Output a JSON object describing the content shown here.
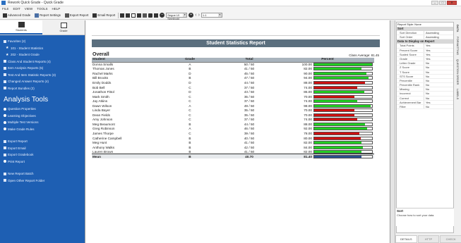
{
  "window": {
    "title": "Rework Quick Grade - Quick Grade"
  },
  "menu": [
    "FILE",
    "EDIT",
    "VIEW",
    "TOOLS",
    "HELP"
  ],
  "toolbar": {
    "buttons": [
      "Advanced Grade",
      "Report Settings",
      "Export Report",
      "Email Report"
    ],
    "font_combo": "Segoe UI Semibold",
    "zoom_combo": "1:1"
  },
  "sidebar": {
    "tabs": [
      "Students",
      "Grade"
    ],
    "items_top": [
      {
        "label": "Favorites (2)"
      },
      {
        "label": "101 - Student Statistics"
      },
      {
        "label": "202 - Student Grade"
      },
      {
        "label": "Class And Student Reports (4)"
      },
      {
        "label": "Item Analysis Reports (5)"
      },
      {
        "label": "Test And Item Statistic Reports (3)"
      },
      {
        "label": "Changed Answer Reports (4)"
      },
      {
        "label": "Report Bundles (2)"
      }
    ],
    "section_title": "Analysis Tools",
    "tools": [
      {
        "label": "Question Properties"
      },
      {
        "label": "Learning Objectives"
      },
      {
        "label": "Multiple Test Versions"
      },
      {
        "label": "Make Grade Rules"
      }
    ],
    "export_items": [
      {
        "label": "Export Report"
      },
      {
        "label": "Export Email"
      },
      {
        "label": "Export Gradebook"
      },
      {
        "label": "Print Report"
      }
    ],
    "bottom_items": [
      {
        "label": "New Report Batch"
      },
      {
        "label": "Open Other Report Folder"
      }
    ]
  },
  "report": {
    "title": "Student Statistics Report",
    "overall_label": "Overall",
    "class_average": "Class Average: 81.45",
    "columns": [
      "Student",
      "Grade",
      "Total",
      "Percent"
    ],
    "rows": [
      {
        "name": "Donna Smalls",
        "grade": "A",
        "total": "50 / 50",
        "pct": "100.00",
        "value": 100,
        "color": "#22cc22"
      },
      {
        "name": "Thomas Jones",
        "grade": "B",
        "total": "41 / 50",
        "pct": "82.00",
        "value": 82,
        "color": "#22cc22"
      },
      {
        "name": "Rachel Marks",
        "grade": "D",
        "total": "45 / 50",
        "pct": "90.00",
        "value": 90,
        "color": "#22cc22"
      },
      {
        "name": "Bill Brooks",
        "grade": "B",
        "total": "47 / 50",
        "pct": "94.00",
        "value": 94,
        "color": "#22cc22"
      },
      {
        "name": "Emily Dodds",
        "grade": "D",
        "total": "44 / 50",
        "pct": "88.00",
        "value": 88,
        "color": "#cc1111"
      },
      {
        "name": "Bob Bell",
        "grade": "C",
        "total": "37 / 50",
        "pct": "74.00",
        "value": 74,
        "color": "#cc1111"
      },
      {
        "name": "Jonathon Fittol",
        "grade": "D",
        "total": "43 / 50",
        "pct": "86.00",
        "value": 86,
        "color": "#22cc22"
      },
      {
        "name": "Mark Smith",
        "grade": "C",
        "total": "35 / 50",
        "pct": "70.00",
        "value": 70,
        "color": "#cc1111"
      },
      {
        "name": "Jay Atkins",
        "grade": "C",
        "total": "37 / 50",
        "pct": "74.00",
        "value": 74,
        "color": "#22cc22"
      },
      {
        "name": "Dawn Wilson",
        "grade": "A",
        "total": "49 / 50",
        "pct": "98.00",
        "value": 98,
        "color": "#22cc22"
      },
      {
        "name": "Linda Bayer",
        "grade": "C",
        "total": "35 / 50",
        "pct": "70.00",
        "value": 70,
        "color": "#cc1111"
      },
      {
        "name": "Dean Fields",
        "grade": "C",
        "total": "35 / 50",
        "pct": "70.00",
        "value": 70,
        "color": "#cc1111"
      },
      {
        "name": "Amy Johnson",
        "grade": "C",
        "total": "37 / 50",
        "pct": "74.00",
        "value": 74,
        "color": "#cc1111"
      },
      {
        "name": "Meg Beaumont",
        "grade": "B",
        "total": "44 / 50",
        "pct": "88.00",
        "value": 88,
        "color": "#22cc22"
      },
      {
        "name": "Greg Robinson",
        "grade": "A",
        "total": "46 / 50",
        "pct": "92.00",
        "value": 92,
        "color": "#22cc22"
      },
      {
        "name": "James Thorpe",
        "grade": "C",
        "total": "39 / 50",
        "pct": "78.00",
        "value": 78,
        "color": "#cc1111"
      },
      {
        "name": "Catherine Campbell",
        "grade": "B",
        "total": "40 / 50",
        "pct": "80.00",
        "value": 80,
        "color": "#cc1111"
      },
      {
        "name": "Meg Hunt",
        "grade": "B",
        "total": "41 / 50",
        "pct": "82.00",
        "value": 82,
        "color": "#22cc22"
      },
      {
        "name": "Anthony Walks",
        "grade": "B",
        "total": "42 / 50",
        "pct": "84.00",
        "value": 84,
        "color": "#22cc22"
      },
      {
        "name": "Lauren Brown",
        "grade": "B",
        "total": "41 / 50",
        "pct": "82.00",
        "value": 82,
        "color": "#22cc22"
      }
    ],
    "mean": {
      "name": "Mean",
      "grade": "B",
      "total": "40.70",
      "pct": "81.40",
      "value": 81.4,
      "color": "#2b4d8c"
    }
  },
  "props": {
    "header": "Report Style: None",
    "group_sort": "Sort",
    "sort_rows": [
      {
        "k": "Sort Direction",
        "v": "Ascending"
      },
      {
        "k": "Sort Order",
        "v": "Ascending"
      }
    ],
    "group_display": "Data to Display on Report",
    "display_rows": [
      {
        "k": "Total Points",
        "v": "Yes"
      },
      {
        "k": "Percent Score",
        "v": "Yes"
      },
      {
        "k": "Scaled Score",
        "v": "Yes"
      },
      {
        "k": "Grade",
        "v": "Yes"
      },
      {
        "k": "Letter Grade",
        "v": "No"
      },
      {
        "k": "Z Score",
        "v": "No"
      },
      {
        "k": "T Score",
        "v": "No"
      },
      {
        "k": "STS Score",
        "v": "No"
      },
      {
        "k": "Percentile",
        "v": "No"
      },
      {
        "k": "Percentile Rank",
        "v": "No"
      },
      {
        "k": "Missing",
        "v": "No"
      },
      {
        "k": "Incorrect",
        "v": "No"
      },
      {
        "k": "Correct",
        "v": "No"
      },
      {
        "k": "Achievement Bar",
        "v": "Yes"
      },
      {
        "k": "Filter",
        "v": "No"
      }
    ],
    "desc_title": "Sort",
    "desc_text": "Choose how to sort your data.",
    "bottom_tabs": [
      "DETAILS",
      "HTTP",
      "CHECK"
    ],
    "vtabs": [
      "DATA",
      "FORMATTING",
      "QUESTION ORDER",
      "LABELS"
    ]
  }
}
